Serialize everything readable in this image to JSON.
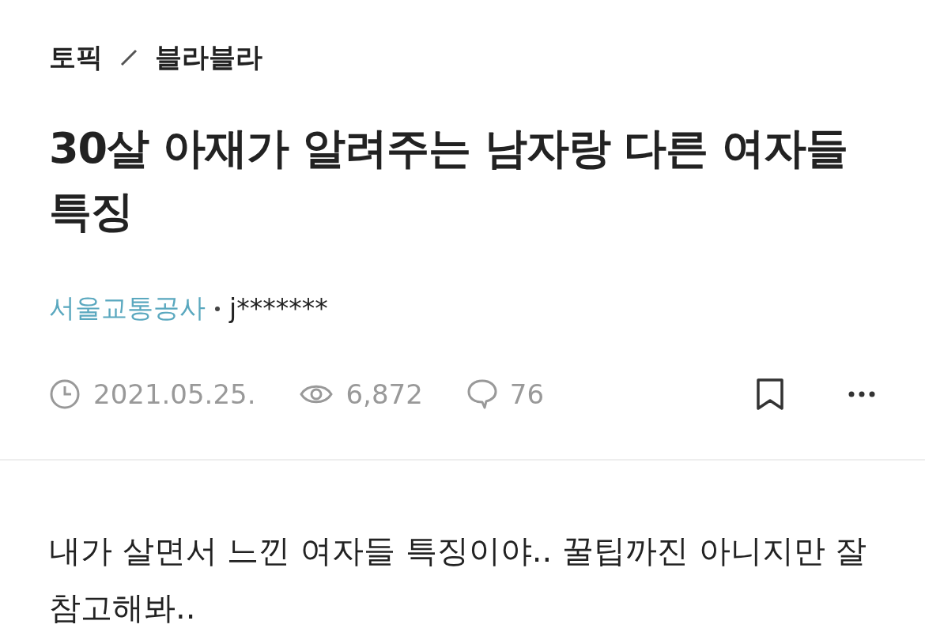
{
  "breadcrumb": [
    "토픽",
    "블라블라"
  ],
  "title": "30살 아재가 알려주는 남자랑 다른 여자들 특징",
  "author": {
    "company": "서울교통공사",
    "nickname": "j*******"
  },
  "meta": {
    "date": "2021.05.25.",
    "views": "6,872",
    "comments": "76",
    "bookmarked": false
  },
  "body": "내가 살면서 느낀 여자들 특징이야.. 꿀팁까진 아니지만 잘 참고해봐.."
}
